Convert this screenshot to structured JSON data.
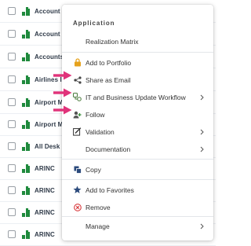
{
  "list": {
    "rows": [
      {
        "label": "Account"
      },
      {
        "label": "Account"
      },
      {
        "label": "Accounts"
      },
      {
        "label": "Airlines I"
      },
      {
        "label": "Airport M"
      },
      {
        "label": "Airport M"
      },
      {
        "label": "All Desk"
      },
      {
        "label": "ARINC"
      },
      {
        "label": "ARINC"
      },
      {
        "label": "ARINC"
      },
      {
        "label": "ARINC"
      }
    ]
  },
  "menu": {
    "header": "Application",
    "items": [
      {
        "label": "Realization Matrix",
        "icon": "none"
      },
      {
        "label": "Add to Portfolio",
        "icon": "lock-icon"
      },
      {
        "label": "Share as Email",
        "icon": "share-icon"
      },
      {
        "label": "IT and Business Update Workflow",
        "icon": "workflow-icon",
        "submenu": true
      },
      {
        "label": "Follow",
        "icon": "follow-icon"
      },
      {
        "label": "Validation",
        "icon": "validation-icon",
        "submenu": true
      },
      {
        "label": "Documentation",
        "icon": "none",
        "submenu": true
      },
      {
        "label": "Copy",
        "icon": "copy-icon"
      },
      {
        "label": "Add to Favorites",
        "icon": "star-icon"
      },
      {
        "label": "Remove",
        "icon": "remove-icon"
      },
      {
        "label": "Manage",
        "icon": "none",
        "submenu": true
      }
    ]
  },
  "colors": {
    "accent_pink": "#e0337a",
    "app_icon_green": "#1f8a3d",
    "star_blue": "#2b4a7c",
    "remove_red": "#d8393c"
  }
}
